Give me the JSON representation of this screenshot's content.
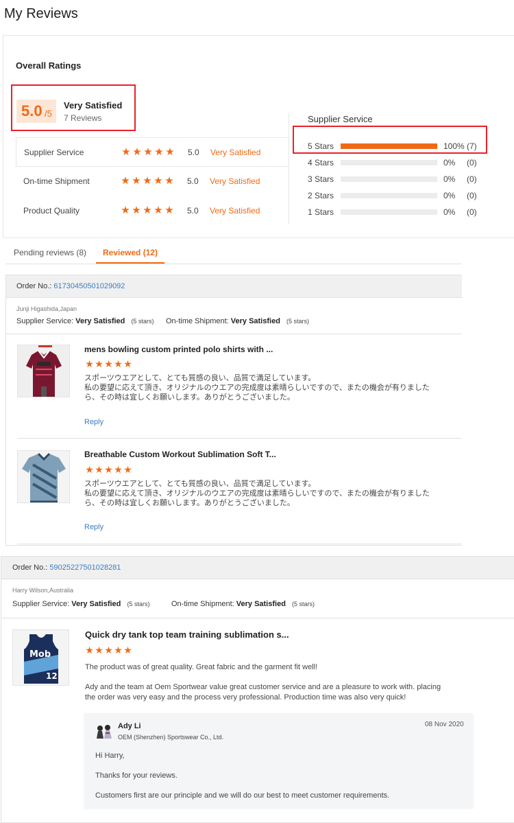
{
  "page": {
    "title": "My Reviews"
  },
  "overall": {
    "heading": "Overall Ratings",
    "score": "5.0",
    "score_max": "/5",
    "label": "Very Satisfied",
    "reviews_count": "7 Reviews",
    "rows": [
      {
        "name": "Supplier Service",
        "stars": 5,
        "value": "5.0",
        "label": "Very Satisfied"
      },
      {
        "name": "On-time Shipment",
        "stars": 5,
        "value": "5.0",
        "label": "Very Satisfied"
      },
      {
        "name": "Product Quality",
        "stars": 5,
        "value": "5.0",
        "label": "Very Satisfied"
      }
    ]
  },
  "supplier_service": {
    "title": "Supplier Service",
    "bars": [
      {
        "label": "5 Stars",
        "fraction": 1.0,
        "percent": "100%",
        "count": "(7)"
      },
      {
        "label": "4 Stars",
        "fraction": 0,
        "percent": "0%",
        "count": "(0)"
      },
      {
        "label": "3 Stars",
        "fraction": 0,
        "percent": "0%",
        "count": "(0)"
      },
      {
        "label": "2 Stars",
        "fraction": 0,
        "percent": "0%",
        "count": "(0)"
      },
      {
        "label": "1 Stars",
        "fraction": 0,
        "percent": "0%",
        "count": "(0)"
      }
    ]
  },
  "tabs": [
    {
      "label": "Pending reviews (8)",
      "active": false
    },
    {
      "label": "Reviewed (12)",
      "active": true
    }
  ],
  "orders": [
    {
      "order_label": "Order No.:",
      "order_no": "61730450501029092",
      "buyer": "Junji Higashida,Japan",
      "supplier_service_label": "Supplier Service:",
      "supplier_service_value": "Very Satisfied",
      "supplier_service_stars": "(5 stars)",
      "shipment_label": "On-time Shipment:",
      "shipment_value": "Very Satisfied",
      "shipment_stars": "(5 stars)",
      "items": [
        {
          "title": "mens bowling custom printed polo shirts with ...",
          "stars": 5,
          "text": [
            "スポーツウエアとして、とても質感の良い、品質で満足しています。",
            "私の要望に応えて頂き、オリジナルのウエアの完成度は素晴らしいですので、またの機会が有りました",
            "ら、その時は宜しくお願いします。ありがとうございました。"
          ],
          "reply": "Reply"
        },
        {
          "title": "Breathable Custom Workout Sublimation Soft T...",
          "stars": 5,
          "text": [
            "スポーツウエアとして、とても質感の良い、品質で満足しています。",
            "私の要望に応えて頂き、オリジナルのウエアの完成度は素晴らしいですので、またの機会が有りました",
            "ら、その時は宜しくお願いします。ありがとうございました。"
          ],
          "reply": "Reply"
        }
      ]
    },
    {
      "order_label": "Order No.:",
      "order_no": "59025227501028281",
      "buyer": "Harry Wilson,Australia",
      "supplier_service_label": "Supplier Service:",
      "supplier_service_value": "Very Satisfied",
      "supplier_service_stars": "(5 stars)",
      "shipment_label": "On-time Shipment:",
      "shipment_value": "Very Satisfied",
      "shipment_stars": "(5 stars)",
      "items": [
        {
          "title": "Quick dry tank top team training sublimation s...",
          "stars": 5,
          "text": [
            "The product was of great quality. Great fabric and the garment fit well!",
            "Ady and the team at Oem Sportwear value great customer service and are a pleasure to work with. placing",
            "the order was very easy and the process very professional. Production time was also very quick!"
          ],
          "jersey_text": "Mob",
          "jersey_number": "12"
        }
      ],
      "seller_reply": {
        "name": "Ady Li",
        "company": "OEM (Shenzhen) Sportswear Co., Ltd.",
        "date": "08 Nov 2020",
        "lines": [
          "Hi Harry,",
          "Thanks for your reviews.",
          "Customers first are our principle and we will do our best to meet customer requirements."
        ]
      }
    }
  ],
  "colors": {
    "accent": "#f06a16",
    "link": "#3a7dc4",
    "highlight_box": "#e8202a"
  },
  "icons": {
    "star": "star-icon",
    "avatar": "avatar-icon"
  }
}
